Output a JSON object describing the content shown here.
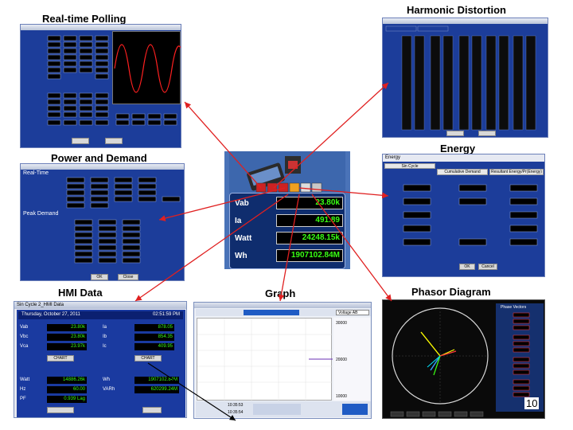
{
  "captions": {
    "realtime": "Real-time Polling",
    "harmonic": "Harmonic Distortion",
    "power": "Power and Demand",
    "energy": "Energy",
    "hmi": "HMI Data",
    "graph": "Graph",
    "phasor": "Phasor Diagram"
  },
  "page_number": "10",
  "meter": {
    "rows": [
      {
        "label": "Vab",
        "value": "23.80k"
      },
      {
        "label": "Ia",
        "value": "491.89"
      },
      {
        "label": "Watt",
        "value": "24248.15k"
      },
      {
        "label": "Wh",
        "value": "1907102.84M"
      }
    ]
  },
  "power_demand": {
    "section1": "Real-Time",
    "section2": "Peak Demand",
    "ok": "OK",
    "close": "Close"
  },
  "energy": {
    "title": "Energy",
    "tabs": [
      "Sin Cycle",
      "Cumulative Demand",
      "Resultant Energy/Pr(Energy)"
    ],
    "ok": "OK",
    "cancel": "Cancel"
  },
  "hmi": {
    "title": "Sin Cycle 2_HMI Data",
    "date": "Thursday, October 27, 2011",
    "time": "02:51:59 PM",
    "left_rows": [
      {
        "label": "Vab",
        "value": "23.80k"
      },
      {
        "label": "Vbc",
        "value": "23.80k"
      },
      {
        "label": "Vca",
        "value": "23.97k"
      }
    ],
    "right_rows": [
      {
        "label": "Ia",
        "value": "878.05"
      },
      {
        "label": "Ib",
        "value": "854.35"
      },
      {
        "label": "Ic",
        "value": "409.95"
      }
    ],
    "left_rows2": [
      {
        "label": "Watt",
        "value": "14886.26k"
      },
      {
        "label": "Hz",
        "value": "60.00"
      },
      {
        "label": "PF",
        "value": "0.939 Lag"
      }
    ],
    "right_rows2": [
      {
        "label": "Wh",
        "value": "1907102.84M"
      },
      {
        "label": "VARh",
        "value": "620299.24M"
      }
    ],
    "chart_btn": "CHART",
    "chart_btn2": "CHART"
  },
  "graph": {
    "dropdown": "Voltage AB",
    "ticks": [
      "30000",
      "20000",
      "10000"
    ],
    "time_label": "10:35:53",
    "time_label2": "10:35:54"
  },
  "phasor": {
    "panel": "Phase Vectors"
  }
}
